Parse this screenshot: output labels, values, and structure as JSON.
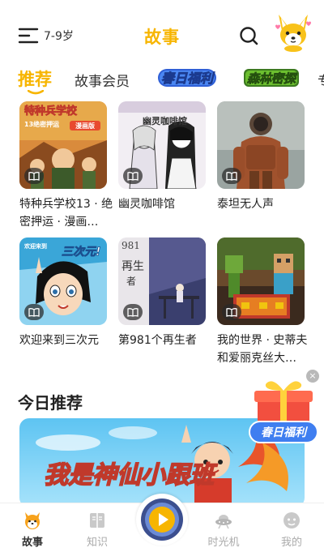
{
  "header": {
    "age_filter": "7-9岁",
    "title": "故事"
  },
  "tabs": [
    {
      "label": "推荐",
      "active": true
    },
    {
      "label": "故事会员",
      "active": false
    },
    {
      "label": "春日福利",
      "active": false,
      "style": "graphic"
    },
    {
      "label": "森林密探",
      "active": false,
      "style": "graphic"
    },
    {
      "label": "专",
      "active": false
    }
  ],
  "stories": [
    {
      "title": "特种兵学校13 · 绝密押运 · 漫画…",
      "cover_text": [
        "特种兵学校",
        "13绝密押运",
        "漫画版"
      ]
    },
    {
      "title": "幽灵咖啡馆",
      "cover_text": [
        "幽灵咖啡馆"
      ]
    },
    {
      "title": "泰坦无人声",
      "cover_text": []
    },
    {
      "title": "欢迎来到三次元",
      "cover_text": [
        "欢迎来到",
        "三次元!"
      ]
    },
    {
      "title": "第981个再生者",
      "cover_text": [
        "981",
        "再生",
        "者"
      ]
    },
    {
      "title": "我的世界 · 史蒂夫和爱丽克丝大…",
      "cover_text": []
    }
  ],
  "today": {
    "title": "今日推荐",
    "banner_text": "我是神仙小跟班"
  },
  "floating_promo": {
    "label": "春日福利",
    "close": "×"
  },
  "bottom_nav": [
    {
      "label": "故事",
      "icon": "fox-icon",
      "active": true
    },
    {
      "label": "知识",
      "icon": "book-icon",
      "active": false
    },
    {
      "label": "",
      "icon": "player-icon",
      "active": false
    },
    {
      "label": "时光机",
      "icon": "ufo-icon",
      "active": false
    },
    {
      "label": "我的",
      "icon": "profile-icon",
      "active": false
    }
  ],
  "colors": {
    "brand": "#f7b500",
    "text": "#222222",
    "inactive": "#aaaaaa"
  }
}
